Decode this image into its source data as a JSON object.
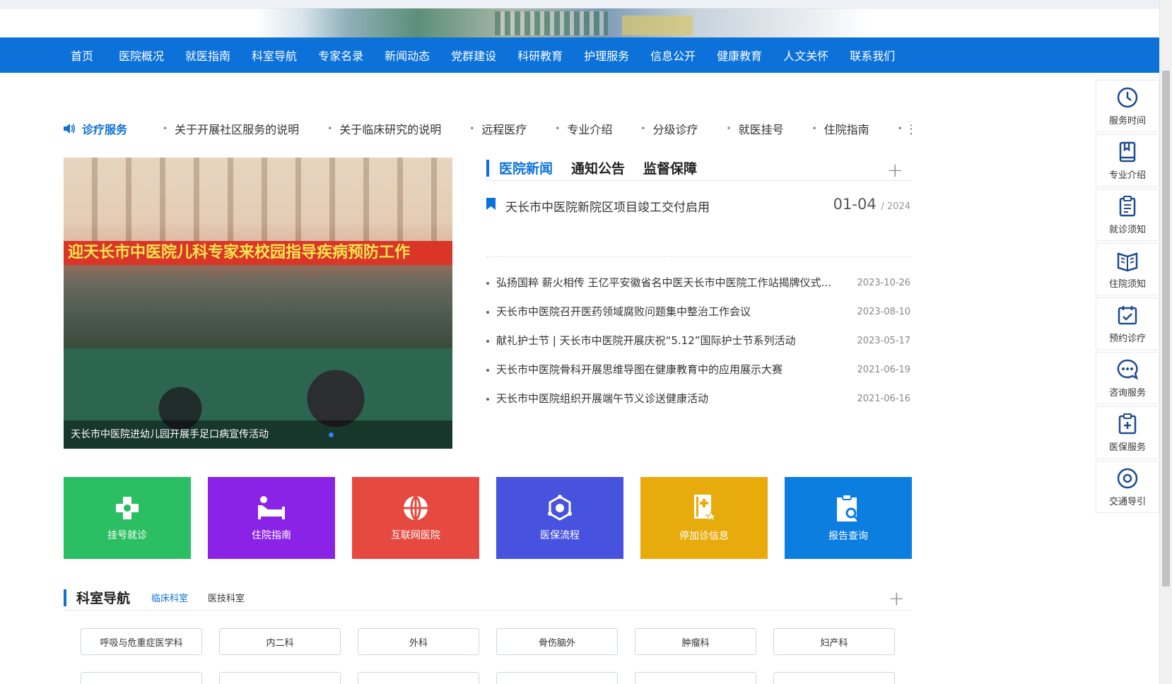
{
  "nav": {
    "items": [
      "首页",
      "医院概况",
      "就医指南",
      "科室导航",
      "专家名录",
      "新闻动态",
      "党群建设",
      "科研教育",
      "护理服务",
      "信息公开",
      "健康教育",
      "人文关怀",
      "联系我们"
    ]
  },
  "service": {
    "lead_label": "诊疗服务",
    "items": [
      "关于开展社区服务的说明",
      "关于临床研究的说明",
      "远程医疗",
      "专业介绍",
      "分级诊疗",
      "就医挂号",
      "住院指南",
      "天"
    ]
  },
  "slider": {
    "banner_text": "迎天长市中医院儿科专家来校园指导疾病预防工作",
    "caption": "天长市中医院进幼儿园开展手足口病宣传活动"
  },
  "news": {
    "tabs": [
      "医院新闻",
      "通知公告",
      "监督保障"
    ],
    "headline": {
      "title": "天长市中医院新院区项目竣工交付启用",
      "date": "01-04",
      "year": "/ 2024"
    },
    "items": [
      {
        "title": "弘扬国粹 薪火相传 王亿平安徽省名中医天长市中医院工作站揭牌仪式...",
        "date": "2023-10-26"
      },
      {
        "title": "天长市中医院召开医药领域腐败问题集中整治工作会议",
        "date": "2023-08-10"
      },
      {
        "title": "献礼护士节 | 天长市中医院开展庆祝“5.12”国际护士节系列活动",
        "date": "2023-05-17"
      },
      {
        "title": "天长市中医院骨科开展思维导图在健康教育中的应用展示大赛",
        "date": "2021-06-19"
      },
      {
        "title": "天长市中医院组织开展端午节义诊送健康活动",
        "date": "2021-06-16"
      }
    ]
  },
  "tiles": [
    {
      "label": "挂号就诊",
      "color": "#2bbe63",
      "icon": "cross-icon"
    },
    {
      "label": "住院指南",
      "color": "#8a23e6",
      "icon": "bed-icon"
    },
    {
      "label": "互联网医院",
      "color": "#e6493f",
      "icon": "globe-icon"
    },
    {
      "label": "医保流程",
      "color": "#4753de",
      "icon": "network-icon"
    },
    {
      "label": "停加诊信息",
      "color": "#e8ab0c",
      "icon": "document-star-icon"
    },
    {
      "label": "报告查询",
      "color": "#0c7ee0",
      "icon": "clipboard-search-icon"
    }
  ],
  "dept": {
    "title": "科室导航",
    "tabs": [
      "临床科室",
      "医技科室"
    ],
    "items": [
      "呼吸与危重症医学科",
      "内二科",
      "外科",
      "骨伤脑外",
      "肿瘤科",
      "妇产科",
      "",
      "",
      "",
      "",
      "",
      ""
    ]
  },
  "side": {
    "items": [
      "服务时间",
      "专业介绍",
      "就诊须知",
      "住院须知",
      "预约诊疗",
      "咨询服务",
      "医保服务",
      "交通导引"
    ]
  },
  "colors": {
    "primary": "#0c71d8",
    "side_icon": "#1e4b8f"
  }
}
